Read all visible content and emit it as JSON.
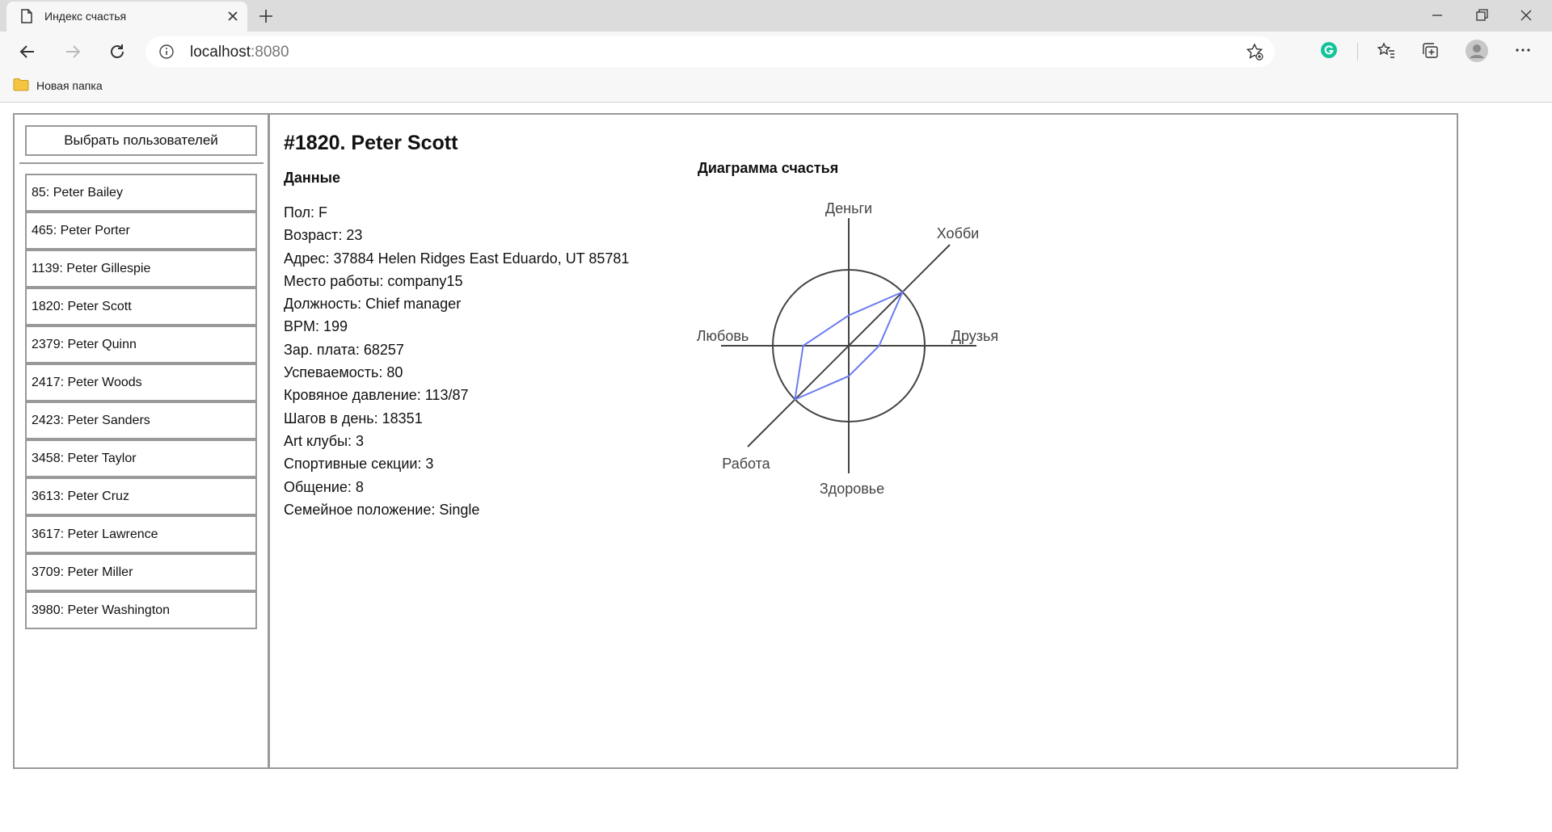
{
  "browser": {
    "tab_title": "Индекс счастья",
    "url_host": "localhost",
    "url_port": ":8080",
    "bookmark_folder": "Новая папка"
  },
  "sidebar": {
    "select_button": "Выбрать пользователей",
    "users": [
      {
        "id": "85",
        "name": "Peter Bailey"
      },
      {
        "id": "465",
        "name": "Peter Porter"
      },
      {
        "id": "1139",
        "name": "Peter Gillespie"
      },
      {
        "id": "1820",
        "name": "Peter Scott"
      },
      {
        "id": "2379",
        "name": "Peter Quinn"
      },
      {
        "id": "2417",
        "name": "Peter Woods"
      },
      {
        "id": "2423",
        "name": "Peter Sanders"
      },
      {
        "id": "3458",
        "name": "Peter Taylor"
      },
      {
        "id": "3613",
        "name": "Peter Cruz"
      },
      {
        "id": "3617",
        "name": "Peter Lawrence"
      },
      {
        "id": "3709",
        "name": "Peter Miller"
      },
      {
        "id": "3980",
        "name": "Peter Washington"
      }
    ]
  },
  "main": {
    "title": "#1820. Peter Scott",
    "data_heading": "Данные",
    "fields": [
      {
        "label": "Пол",
        "value": "F"
      },
      {
        "label": "Возраст",
        "value": "23"
      },
      {
        "label": "Адрес",
        "value": "37884 Helen Ridges East Eduardo, UT 85781"
      },
      {
        "label": "Место работы",
        "value": "company15"
      },
      {
        "label": "Должность",
        "value": "Chief manager"
      },
      {
        "label": "BPM",
        "value": "199"
      },
      {
        "label": "Зар. плата",
        "value": "68257"
      },
      {
        "label": "Успеваемость",
        "value": "80"
      },
      {
        "label": "Кровяное давление",
        "value": "113/87"
      },
      {
        "label": "Шагов в день",
        "value": "18351"
      },
      {
        "label": "Art клубы",
        "value": "3"
      },
      {
        "label": "Спортивные секции",
        "value": "3"
      },
      {
        "label": "Общение",
        "value": "8"
      },
      {
        "label": "Семейное положение",
        "value": "Single"
      }
    ],
    "chart_heading": "Диаграмма счастья"
  },
  "chart_data": {
    "type": "radar",
    "title": "Диаграмма счастья",
    "axes": [
      "Деньги",
      "Хобби",
      "Друзья",
      "Здоровье",
      "Работа",
      "Любовь"
    ],
    "values": [
      0.4,
      1.0,
      0.4,
      0.4,
      1.0,
      0.6
    ],
    "range": [
      0,
      1
    ],
    "reference_circle": 1.0,
    "series_color": "#6b7cf0",
    "axis_color": "#444444"
  }
}
